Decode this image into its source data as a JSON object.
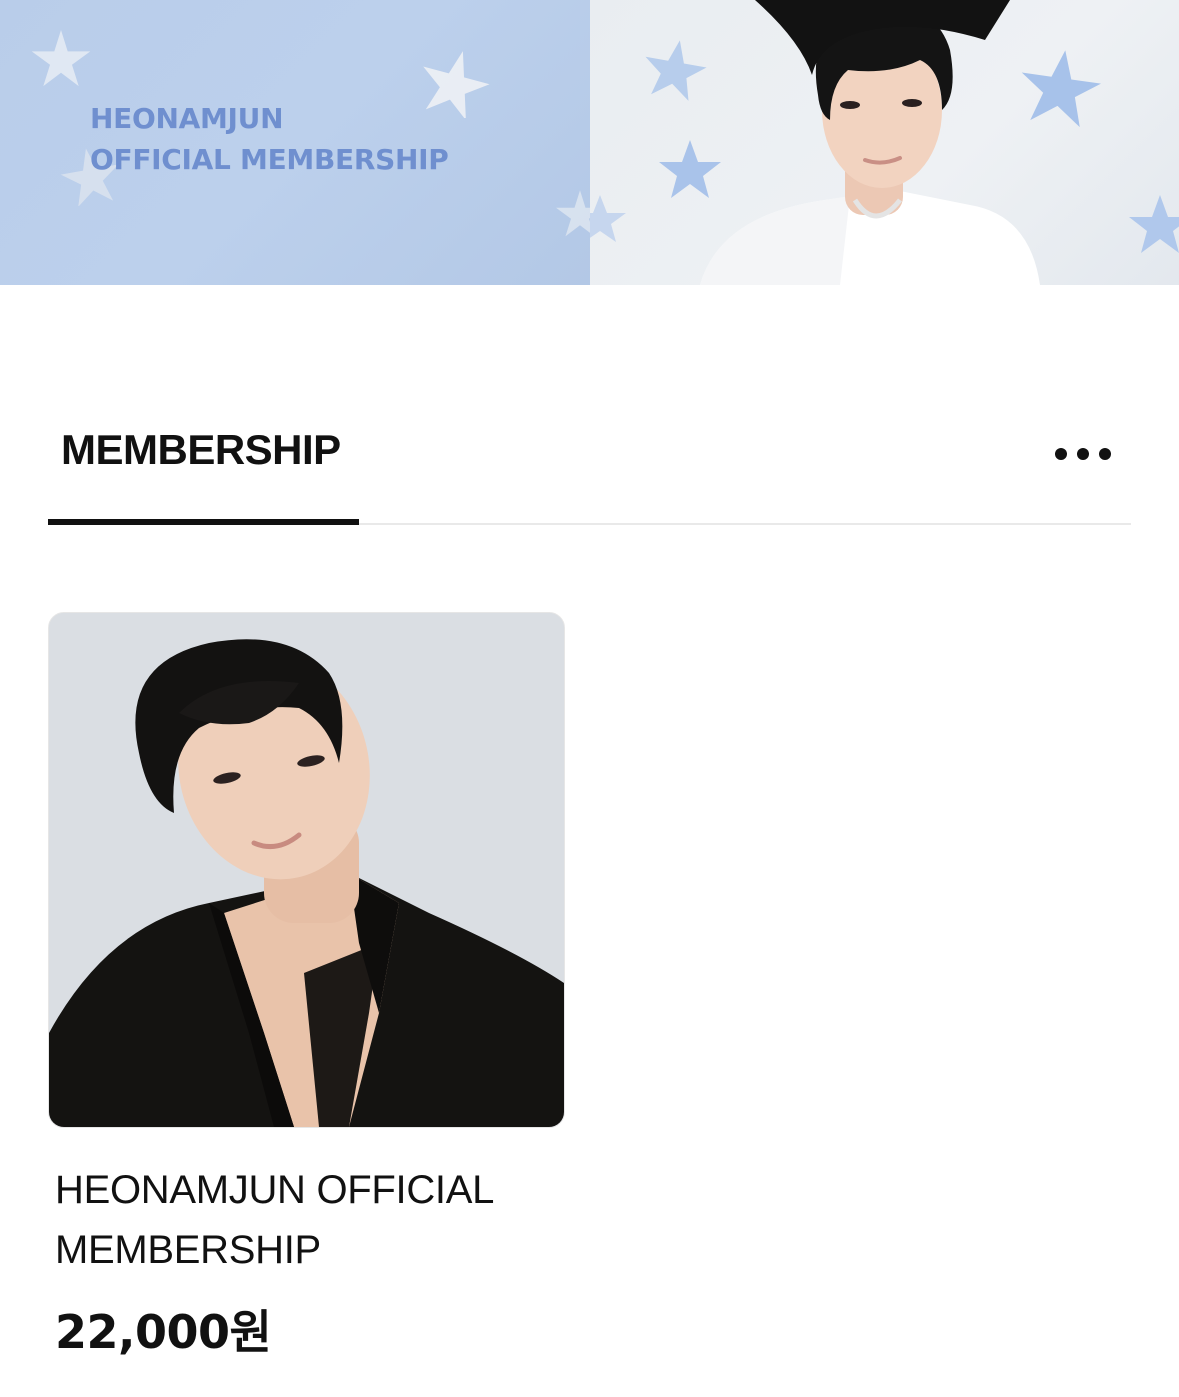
{
  "banner": {
    "title_line1": "HEONAMJUN",
    "title_line2": "OFFICIAL MEMBERSHIP",
    "photo": "artist-portrait-white-tshirt"
  },
  "tabs": {
    "active_label": "MEMBERSHIP",
    "more_icon": "more-dots-icon"
  },
  "products": [
    {
      "title": "HEONAMJUN OFFICIAL MEMBERSHIP",
      "price": "22,000원",
      "photo": "artist-portrait-black-jacket"
    }
  ],
  "colors": {
    "banner_left_bg": "#b9cdea",
    "banner_title": "#6f8fcf",
    "banner_star_left": "#e6ecf4",
    "banner_star_right": "#a7c2ea",
    "tab_active": "#111111",
    "divider": "#e9e9e9"
  }
}
